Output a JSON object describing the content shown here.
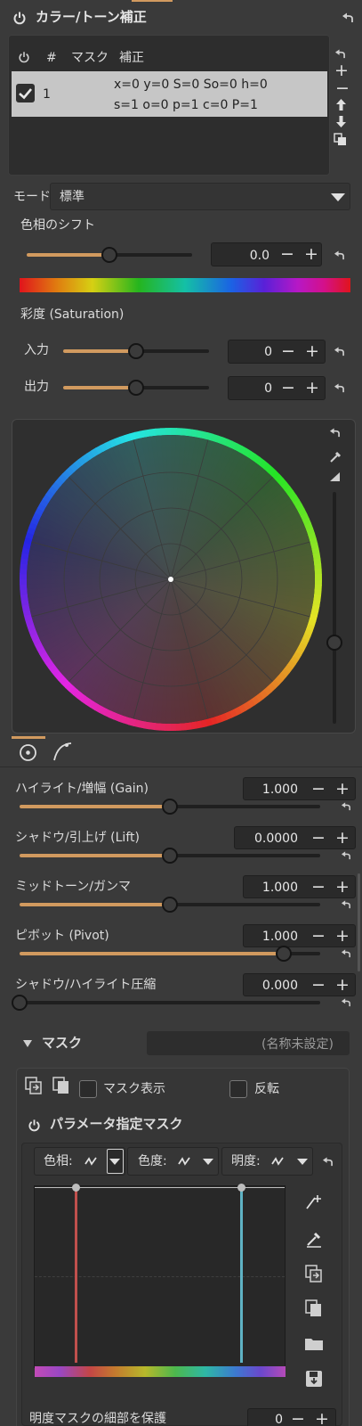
{
  "header": {
    "title": "カラー/トーン補正"
  },
  "layers": {
    "col_power": "",
    "col_num": "#",
    "col_mask": "マスク",
    "col_correction": "補正",
    "row": {
      "num": "1",
      "line1": "x=0 y=0 S=0 So=0 h=0",
      "line2": "s=1 o=0 p=1 c=0 P=1",
      "checked": true
    }
  },
  "mode": {
    "label": "モード:",
    "value": "標準"
  },
  "hue_shift": {
    "label": "色相のシフト",
    "value": "0.0",
    "fraction": 0.5
  },
  "saturation": {
    "label": "彩度 (Saturation)",
    "input": {
      "label": "入力",
      "value": "0",
      "fraction": 0.5
    },
    "output": {
      "label": "出力",
      "value": "0",
      "fraction": 0.5
    }
  },
  "tabs": {
    "wheel": "wheel-icon",
    "curve": "curve-icon"
  },
  "sliders": [
    {
      "label": "ハイライト/増幅 (Gain)",
      "value": "1.000",
      "fraction": 0.5
    },
    {
      "label": "シャドウ/引上げ (Lift)",
      "value": "0.0000",
      "fraction": 0.5
    },
    {
      "label": "ミッドトーン/ガンマ",
      "value": "1.000",
      "fraction": 0.5
    },
    {
      "label": "ピボット (Pivot)",
      "value": "1.000",
      "fraction": 0.88
    },
    {
      "label": "シャドウ/ハイライト圧縮",
      "value": "0.000",
      "fraction": 0.0
    }
  ],
  "mask": {
    "title": "マスク",
    "name_placeholder": "(名称未設定)",
    "show_mask": "マスク表示",
    "invert": "反転",
    "param_title": "パラメータ指定マスク",
    "tabs": [
      "色相:",
      "色度:",
      "明度:"
    ],
    "protect_label": "明度マスクの細部を保護",
    "protect_value": "0"
  },
  "colors": {
    "accent": "#d19a5f",
    "bg": "#3a3a3a",
    "panel": "#333333"
  }
}
